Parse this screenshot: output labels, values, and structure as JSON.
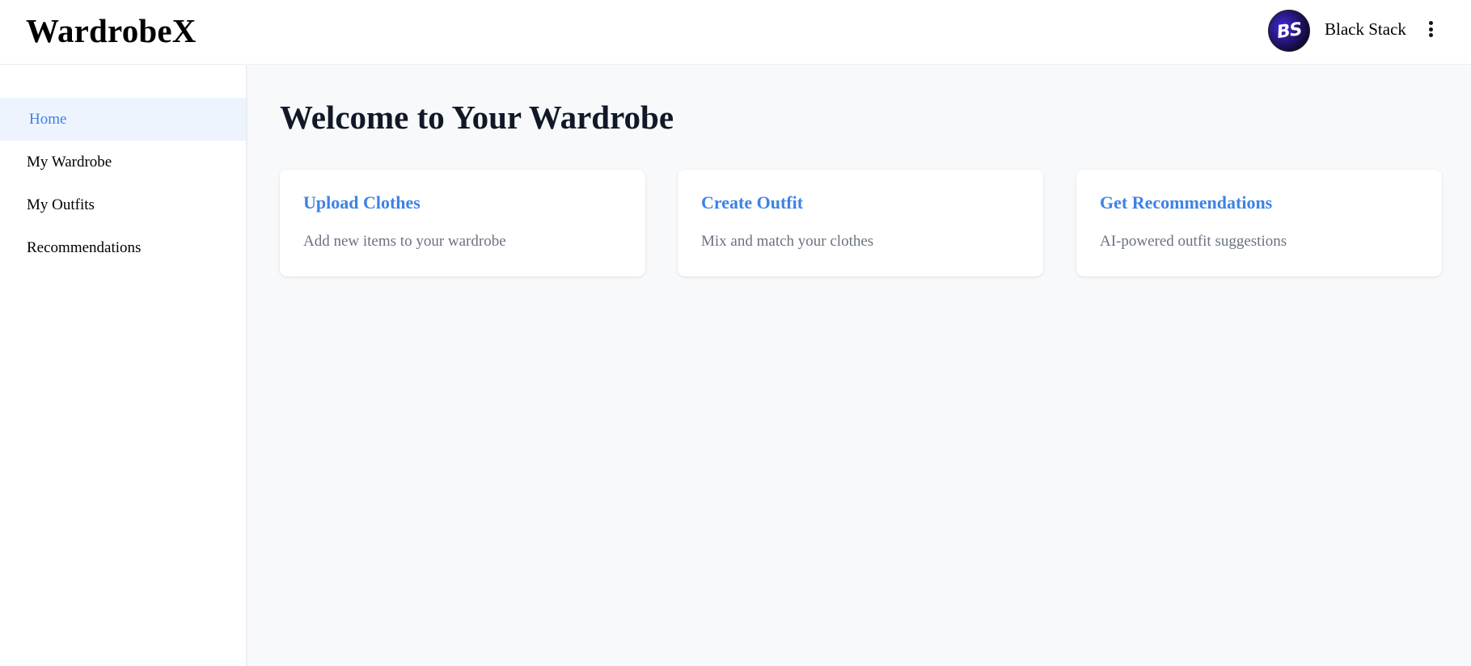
{
  "header": {
    "brand": "WardrobeX",
    "user": {
      "initials": "BS",
      "name": "Black Stack",
      "menu_icon": "more-vertical-icon"
    }
  },
  "sidebar": {
    "items": [
      {
        "label": "Home",
        "active": true
      },
      {
        "label": "My Wardrobe",
        "active": false
      },
      {
        "label": "My Outfits",
        "active": false
      },
      {
        "label": "Recommendations",
        "active": false
      }
    ]
  },
  "main": {
    "title": "Welcome to Your Wardrobe",
    "cards": [
      {
        "title": "Upload Clothes",
        "description": "Add new items to your wardrobe"
      },
      {
        "title": "Create Outfit",
        "description": "Mix and match your clothes"
      },
      {
        "title": "Get Recommendations",
        "description": "AI-powered outfit suggestions"
      }
    ]
  },
  "colors": {
    "accent": "#3d82e6",
    "active_bg": "#eef4fd",
    "page_bg": "#f8f9fb",
    "muted_text": "#6b7280"
  }
}
